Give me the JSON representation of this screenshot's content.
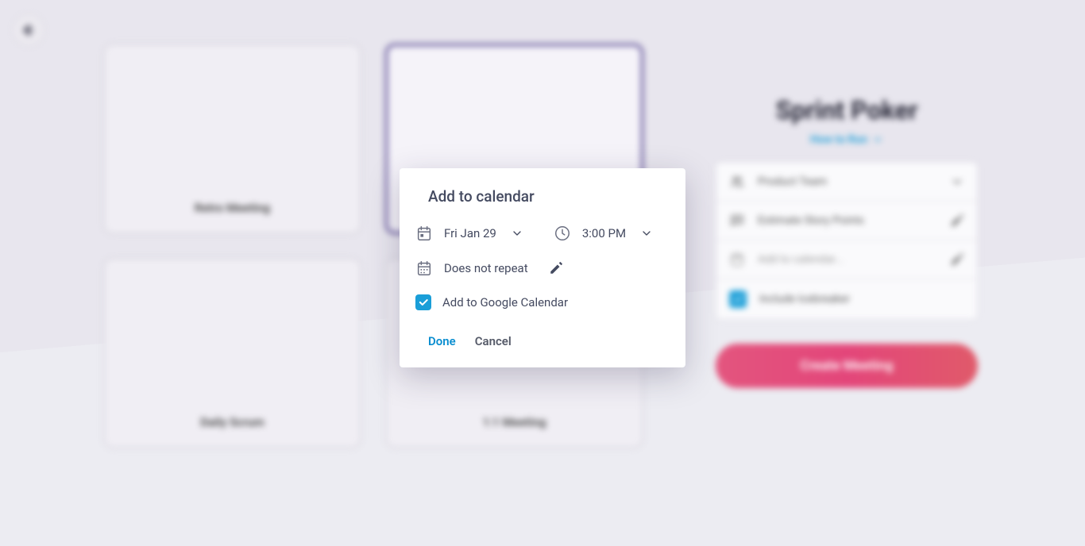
{
  "cards": {
    "retro": "Retro Meeting",
    "daily": "Daily Scrum",
    "oneonone": "1:1 Meeting"
  },
  "panel": {
    "title": "Sprint Poker",
    "howToRun": "How to Run",
    "team": "Product Team",
    "estimate": "Estimate Story Points",
    "addCalendar": "Add to calendar...",
    "icebreaker": "Include Icebreaker",
    "createBtn": "Create Meeting"
  },
  "modal": {
    "title": "Add to calendar",
    "date": "Fri Jan 29",
    "time": "3:00 PM",
    "repeat": "Does not repeat",
    "googleCal": "Add to Google Calendar",
    "done": "Done",
    "cancel": "Cancel"
  }
}
